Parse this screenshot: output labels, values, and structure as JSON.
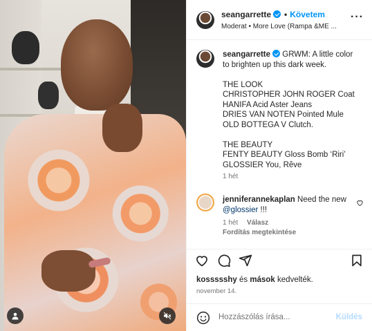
{
  "header": {
    "username": "seangarrette",
    "follow_label": "Követem",
    "subtitle": "Moderat • More Love (Rampa &ME ..."
  },
  "caption": {
    "username": "seangarrette",
    "lines": [
      "GRWM: A little color",
      "to brighten up this dark week.",
      "",
      "THE LOOK",
      "CHRISTOPHER JOHN ROGER Coat",
      "HANIFA Acid Aster Jeans",
      "DRIES VAN NOTEN Pointed Mule",
      "OLD BOTTEGA V Clutch.",
      "",
      "THE BEAUTY",
      "FENTY BEAUTY Gloss Bomb ‘Riri’",
      "GLOSSIER You, Rêve"
    ],
    "time": "1 hét"
  },
  "comment": {
    "username": "jenniferannekaplan",
    "text_before": "Need the new",
    "mention": "@glossier",
    "text_after": "!!!",
    "time": "1 hét",
    "reply_label": "Válasz",
    "translate_label": "Fordítás megtekintése"
  },
  "likes": {
    "user": "kossssshy",
    "and": "és",
    "others": "mások",
    "suffix": "kedvelték."
  },
  "date": "november 14.",
  "add_comment": {
    "placeholder": "Hozzászólás írása...",
    "post_label": "Küldés"
  },
  "icons": {
    "user": "user-tag-icon",
    "mute": "muted-speaker-icon",
    "like": "heart-icon",
    "comment": "comment-icon",
    "share": "share-icon",
    "save": "bookmark-icon",
    "emoji": "emoji-icon"
  }
}
